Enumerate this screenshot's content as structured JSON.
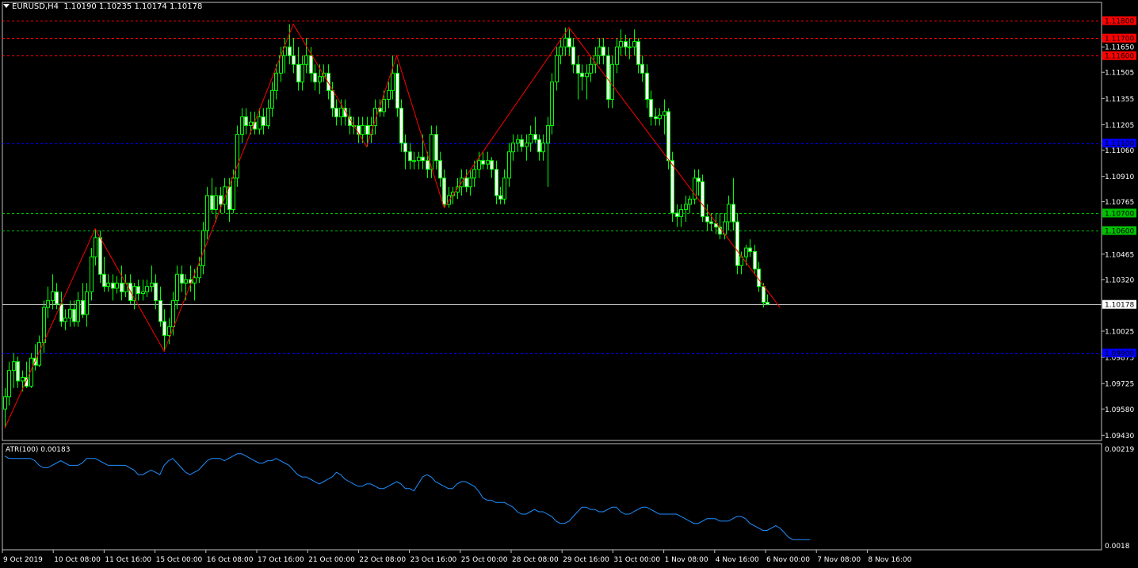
{
  "header": {
    "symbol": "EURUSD,H4",
    "ohlc": "1.10190 1.10235 1.10174 1.10178"
  },
  "indicator": {
    "label": "ATR(100) 0.00183",
    "ticks": [
      "0.00219",
      "0.0018"
    ]
  },
  "colors": {
    "background": "#000000",
    "bull": "#00ff00",
    "bear": "#ffffff",
    "zigzag": "#ff0000",
    "atr_line": "#1e90ff",
    "level_red": "#ff0000",
    "level_blue": "#0000ff",
    "level_green": "#00c000",
    "last_price": "#c0c0c0"
  },
  "chart_data": {
    "type": "candlestick",
    "symbol": "EURUSD",
    "timeframe": "H4",
    "ylim": [
      1.094,
      1.119
    ],
    "price_ticks": [
      "1.11650",
      "1.11505",
      "1.11355",
      "1.11205",
      "1.11060",
      "1.10910",
      "1.10765",
      "1.10465",
      "1.10320",
      "1.10025",
      "1.09875",
      "1.09725",
      "1.09580",
      "1.09430"
    ],
    "x_labels": [
      "9 Oct 2019",
      "10 Oct 08:00",
      "11 Oct 16:00",
      "15 Oct 00:00",
      "16 Oct 08:00",
      "17 Oct 16:00",
      "21 Oct 00:00",
      "22 Oct 08:00",
      "23 Oct 16:00",
      "25 Oct 00:00",
      "28 Oct 08:00",
      "29 Oct 16:00",
      "31 Oct 00:00",
      "1 Nov 08:00",
      "4 Nov 16:00",
      "6 Nov 00:00",
      "7 Nov 08:00",
      "8 Nov 16:00"
    ],
    "levels": [
      {
        "price": 1.118,
        "label": "1.11800",
        "color": "red"
      },
      {
        "price": 1.117,
        "label": "1.11700",
        "color": "red"
      },
      {
        "price": 1.116,
        "label": "1.11600",
        "color": "red"
      },
      {
        "price": 1.111,
        "label": "1.11100",
        "color": "blue"
      },
      {
        "price": 1.107,
        "label": "1.10700",
        "color": "green"
      },
      {
        "price": 1.106,
        "label": "1.10600",
        "color": "green"
      },
      {
        "price": 1.099,
        "label": "1.09900",
        "color": "blue"
      }
    ],
    "last_price": {
      "price": 1.10178,
      "label": "1.10178"
    },
    "zigzag": [
      {
        "bar": 0,
        "price": 1.0947
      },
      {
        "bar": 21,
        "price": 1.1061
      },
      {
        "bar": 37,
        "price": 1.0991
      },
      {
        "bar": 67,
        "price": 1.1178
      },
      {
        "bar": 84,
        "price": 1.1108
      },
      {
        "bar": 91,
        "price": 1.116
      },
      {
        "bar": 102,
        "price": 1.1073
      },
      {
        "bar": 131,
        "price": 1.1176
      },
      {
        "bar": 180,
        "price": 1.1016
      }
    ],
    "candles": [
      [
        1.0958,
        1.097,
        1.0947,
        1.0965
      ],
      [
        1.0965,
        1.0985,
        1.096,
        1.098
      ],
      [
        1.098,
        1.099,
        1.097,
        1.0985
      ],
      [
        1.0985,
        1.0988,
        1.097,
        1.0974
      ],
      [
        1.0974,
        1.098,
        1.0968,
        1.0976
      ],
      [
        1.0976,
        1.0985,
        1.097,
        1.0971
      ],
      [
        1.0971,
        1.099,
        1.097,
        1.0987
      ],
      [
        1.0987,
        1.0995,
        1.098,
        1.0983
      ],
      [
        1.0983,
        1.1,
        1.0982,
        1.0996
      ],
      [
        1.0996,
        1.102,
        1.099,
        1.1016
      ],
      [
        1.1016,
        1.1028,
        1.101,
        1.102
      ],
      [
        1.102,
        1.1035,
        1.1015,
        1.1025
      ],
      [
        1.1025,
        1.103,
        1.1015,
        1.1018
      ],
      [
        1.1018,
        1.1025,
        1.1005,
        1.1008
      ],
      [
        1.1008,
        1.1015,
        1.1003,
        1.101
      ],
      [
        1.101,
        1.102,
        1.1005,
        1.1015
      ],
      [
        1.1015,
        1.102,
        1.1005,
        1.1008
      ],
      [
        1.1008,
        1.1025,
        1.1005,
        1.102
      ],
      [
        1.102,
        1.103,
        1.101,
        1.1012
      ],
      [
        1.1012,
        1.103,
        1.1005,
        1.1025
      ],
      [
        1.1025,
        1.105,
        1.102,
        1.1045
      ],
      [
        1.1045,
        1.1061,
        1.104,
        1.1056
      ],
      [
        1.1056,
        1.106,
        1.103,
        1.1035
      ],
      [
        1.1035,
        1.1045,
        1.1025,
        1.1028
      ],
      [
        1.1028,
        1.1035,
        1.1025,
        1.103
      ],
      [
        1.103,
        1.1035,
        1.102,
        1.1027
      ],
      [
        1.1027,
        1.1034,
        1.1024,
        1.103
      ],
      [
        1.103,
        1.104,
        1.102,
        1.1025
      ],
      [
        1.1025,
        1.1035,
        1.1022,
        1.103
      ],
      [
        1.103,
        1.1035,
        1.1018,
        1.102
      ],
      [
        1.102,
        1.103,
        1.1015,
        1.1028
      ],
      [
        1.1028,
        1.1032,
        1.102,
        1.1024
      ],
      [
        1.1024,
        1.1032,
        1.102,
        1.1025
      ],
      [
        1.1025,
        1.1032,
        1.1022,
        1.1028
      ],
      [
        1.1028,
        1.104,
        1.1025,
        1.103
      ],
      [
        1.103,
        1.1035,
        1.1015,
        1.102
      ],
      [
        1.102,
        1.1028,
        1.1005,
        1.1008
      ],
      [
        1.1008,
        1.1015,
        1.0991,
        1.1
      ],
      [
        1.1,
        1.101,
        1.0995,
        1.1005
      ],
      [
        1.1005,
        1.1025,
        1.1,
        1.102
      ],
      [
        1.102,
        1.104,
        1.1015,
        1.1035
      ],
      [
        1.1035,
        1.104,
        1.1025,
        1.103
      ],
      [
        1.103,
        1.1035,
        1.102,
        1.1032
      ],
      [
        1.1032,
        1.104,
        1.1025,
        1.103
      ],
      [
        1.103,
        1.1038,
        1.102,
        1.1033
      ],
      [
        1.1033,
        1.1045,
        1.103,
        1.104
      ],
      [
        1.104,
        1.1065,
        1.1035,
        1.106
      ],
      [
        1.106,
        1.1085,
        1.1055,
        1.108
      ],
      [
        1.108,
        1.109,
        1.107,
        1.1072
      ],
      [
        1.1072,
        1.1085,
        1.1065,
        1.108
      ],
      [
        1.108,
        1.1085,
        1.107,
        1.1075
      ],
      [
        1.1075,
        1.109,
        1.107,
        1.1085
      ],
      [
        1.1085,
        1.109,
        1.1065,
        1.1072
      ],
      [
        1.1072,
        1.1095,
        1.107,
        1.109
      ],
      [
        1.109,
        1.112,
        1.1085,
        1.1115
      ],
      [
        1.1115,
        1.113,
        1.111,
        1.1125
      ],
      [
        1.1125,
        1.113,
        1.1115,
        1.112
      ],
      [
        1.112,
        1.1128,
        1.1115,
        1.1122
      ],
      [
        1.1122,
        1.1128,
        1.1115,
        1.1118
      ],
      [
        1.1118,
        1.113,
        1.1115,
        1.1125
      ],
      [
        1.1125,
        1.113,
        1.1115,
        1.112
      ],
      [
        1.112,
        1.1135,
        1.1118,
        1.113
      ],
      [
        1.113,
        1.1145,
        1.1125,
        1.114
      ],
      [
        1.114,
        1.1155,
        1.1135,
        1.115
      ],
      [
        1.115,
        1.1165,
        1.1145,
        1.116
      ],
      [
        1.116,
        1.117,
        1.115,
        1.1165
      ],
      [
        1.1165,
        1.1178,
        1.1155,
        1.116
      ],
      [
        1.116,
        1.117,
        1.115,
        1.1155
      ],
      [
        1.1155,
        1.1165,
        1.114,
        1.1145
      ],
      [
        1.1145,
        1.116,
        1.114,
        1.1155
      ],
      [
        1.1155,
        1.117,
        1.115,
        1.116
      ],
      [
        1.116,
        1.1165,
        1.1145,
        1.115
      ],
      [
        1.115,
        1.1155,
        1.114,
        1.1145
      ],
      [
        1.1145,
        1.1155,
        1.1138,
        1.1148
      ],
      [
        1.1148,
        1.1155,
        1.1145,
        1.115
      ],
      [
        1.115,
        1.1155,
        1.1135,
        1.114
      ],
      [
        1.114,
        1.1145,
        1.1125,
        1.113
      ],
      [
        1.113,
        1.1135,
        1.112,
        1.1125
      ],
      [
        1.1125,
        1.1135,
        1.112,
        1.113
      ],
      [
        1.113,
        1.1135,
        1.112,
        1.1125
      ],
      [
        1.1125,
        1.113,
        1.1115,
        1.112
      ],
      [
        1.112,
        1.1125,
        1.1115,
        1.112
      ],
      [
        1.112,
        1.1125,
        1.111,
        1.1115
      ],
      [
        1.1115,
        1.1125,
        1.111,
        1.112
      ],
      [
        1.112,
        1.1125,
        1.1108,
        1.1115
      ],
      [
        1.1115,
        1.1125,
        1.111,
        1.112
      ],
      [
        1.112,
        1.1135,
        1.1115,
        1.113
      ],
      [
        1.113,
        1.1135,
        1.1125,
        1.1128
      ],
      [
        1.1128,
        1.114,
        1.1125,
        1.1135
      ],
      [
        1.1135,
        1.1145,
        1.113,
        1.114
      ],
      [
        1.114,
        1.116,
        1.1135,
        1.115
      ],
      [
        1.115,
        1.1155,
        1.1125,
        1.113
      ],
      [
        1.113,
        1.1135,
        1.1105,
        1.111
      ],
      [
        1.111,
        1.1115,
        1.1095,
        1.1105
      ],
      [
        1.1105,
        1.111,
        1.1095,
        1.11
      ],
      [
        1.11,
        1.1105,
        1.1095,
        1.11
      ],
      [
        1.11,
        1.1105,
        1.1095,
        1.1102
      ],
      [
        1.1102,
        1.1115,
        1.1095,
        1.11
      ],
      [
        1.11,
        1.1105,
        1.109,
        1.1095
      ],
      [
        1.1095,
        1.112,
        1.109,
        1.1115
      ],
      [
        1.1115,
        1.112,
        1.1095,
        1.11
      ],
      [
        1.11,
        1.1105,
        1.1085,
        1.109
      ],
      [
        1.109,
        1.1095,
        1.1073,
        1.1075
      ],
      [
        1.1075,
        1.1085,
        1.1073,
        1.108
      ],
      [
        1.108,
        1.1085,
        1.1075,
        1.1082
      ],
      [
        1.1082,
        1.109,
        1.1078,
        1.1085
      ],
      [
        1.1085,
        1.1095,
        1.108,
        1.109
      ],
      [
        1.109,
        1.1095,
        1.1082,
        1.1085
      ],
      [
        1.1085,
        1.1095,
        1.108,
        1.109
      ],
      [
        1.109,
        1.11,
        1.1085,
        1.1095
      ],
      [
        1.1095,
        1.1105,
        1.109,
        1.11
      ],
      [
        1.11,
        1.1105,
        1.1095,
        1.1098
      ],
      [
        1.1098,
        1.1105,
        1.1095,
        1.11
      ],
      [
        1.11,
        1.1102,
        1.109,
        1.1095
      ],
      [
        1.1095,
        1.11,
        1.1075,
        1.108
      ],
      [
        1.108,
        1.1085,
        1.1075,
        1.1078
      ],
      [
        1.1078,
        1.1095,
        1.1075,
        1.109
      ],
      [
        1.109,
        1.111,
        1.1085,
        1.1105
      ],
      [
        1.1105,
        1.1115,
        1.11,
        1.111
      ],
      [
        1.111,
        1.1115,
        1.1105,
        1.1112
      ],
      [
        1.1112,
        1.1115,
        1.1105,
        1.1108
      ],
      [
        1.1108,
        1.1115,
        1.11,
        1.111
      ],
      [
        1.111,
        1.112,
        1.1105,
        1.1115
      ],
      [
        1.1115,
        1.1125,
        1.111,
        1.1112
      ],
      [
        1.1112,
        1.1115,
        1.11,
        1.1105
      ],
      [
        1.1105,
        1.1115,
        1.11,
        1.111
      ],
      [
        1.111,
        1.1125,
        1.1085,
        1.112
      ],
      [
        1.112,
        1.115,
        1.1115,
        1.1145
      ],
      [
        1.1145,
        1.1165,
        1.114,
        1.116
      ],
      [
        1.116,
        1.117,
        1.1155,
        1.1165
      ],
      [
        1.1165,
        1.1176,
        1.116,
        1.117
      ],
      [
        1.117,
        1.1175,
        1.116,
        1.1165
      ],
      [
        1.1165,
        1.117,
        1.115,
        1.1155
      ],
      [
        1.1155,
        1.116,
        1.1135,
        1.115
      ],
      [
        1.115,
        1.1155,
        1.114,
        1.1148
      ],
      [
        1.1148,
        1.1155,
        1.1135,
        1.115
      ],
      [
        1.115,
        1.116,
        1.1145,
        1.1155
      ],
      [
        1.1155,
        1.1165,
        1.115,
        1.116
      ],
      [
        1.116,
        1.117,
        1.1155,
        1.1165
      ],
      [
        1.1165,
        1.117,
        1.1155,
        1.116
      ],
      [
        1.116,
        1.1165,
        1.113,
        1.1135
      ],
      [
        1.1135,
        1.116,
        1.113,
        1.1155
      ],
      [
        1.1155,
        1.117,
        1.115,
        1.1165
      ],
      [
        1.1165,
        1.1175,
        1.116,
        1.1168
      ],
      [
        1.1168,
        1.1172,
        1.116,
        1.1165
      ],
      [
        1.1165,
        1.117,
        1.1158,
        1.1165
      ],
      [
        1.1165,
        1.1175,
        1.116,
        1.1168
      ],
      [
        1.1168,
        1.117,
        1.115,
        1.1155
      ],
      [
        1.1155,
        1.116,
        1.1145,
        1.115
      ],
      [
        1.115,
        1.1155,
        1.113,
        1.1135
      ],
      [
        1.1135,
        1.114,
        1.112,
        1.1125
      ],
      [
        1.1125,
        1.113,
        1.112,
        1.1124
      ],
      [
        1.1124,
        1.113,
        1.112,
        1.1126
      ],
      [
        1.1126,
        1.1135,
        1.1115,
        1.1128
      ],
      [
        1.1128,
        1.113,
        1.1095,
        1.11
      ],
      [
        1.11,
        1.1105,
        1.1065,
        1.107
      ],
      [
        1.107,
        1.1075,
        1.1062,
        1.1068
      ],
      [
        1.1068,
        1.1075,
        1.1062,
        1.1072
      ],
      [
        1.1072,
        1.108,
        1.1065,
        1.1075
      ],
      [
        1.1075,
        1.108,
        1.107,
        1.1078
      ],
      [
        1.1078,
        1.1095,
        1.1075,
        1.109
      ],
      [
        1.109,
        1.1095,
        1.108,
        1.1088
      ],
      [
        1.1088,
        1.1092,
        1.1065,
        1.1068
      ],
      [
        1.1068,
        1.1075,
        1.106,
        1.1065
      ],
      [
        1.1065,
        1.107,
        1.106,
        1.1064
      ],
      [
        1.1064,
        1.107,
        1.1058,
        1.1062
      ],
      [
        1.1062,
        1.107,
        1.1055,
        1.1058
      ],
      [
        1.1058,
        1.107,
        1.1055,
        1.1065
      ],
      [
        1.1065,
        1.108,
        1.106,
        1.1075
      ],
      [
        1.1075,
        1.109,
        1.106,
        1.1065
      ],
      [
        1.1065,
        1.107,
        1.1035,
        1.104
      ],
      [
        1.104,
        1.1048,
        1.1035,
        1.1045
      ],
      [
        1.1045,
        1.1052,
        1.104,
        1.105
      ],
      [
        1.105,
        1.1055,
        1.1045,
        1.1048
      ],
      [
        1.1048,
        1.1052,
        1.1035,
        1.1038
      ],
      [
        1.1038,
        1.1042,
        1.1025,
        1.1028
      ],
      [
        1.1028,
        1.103,
        1.1016,
        1.1019
      ],
      [
        1.1019,
        1.10235,
        1.10174,
        1.10178
      ]
    ],
    "atr": {
      "name": "ATR(100)",
      "ylim": [
        0.00178,
        0.00221
      ],
      "values": [
        0.00217,
        0.00216,
        0.00216,
        0.00216,
        0.00216,
        0.00216,
        0.00216,
        0.00215,
        0.00213,
        0.00212,
        0.00212,
        0.00213,
        0.00214,
        0.00215,
        0.00214,
        0.00213,
        0.00213,
        0.00213,
        0.00214,
        0.00216,
        0.00216,
        0.00216,
        0.00215,
        0.00214,
        0.00213,
        0.00213,
        0.00213,
        0.00213,
        0.00213,
        0.00212,
        0.00211,
        0.00209,
        0.00209,
        0.0021,
        0.00211,
        0.0021,
        0.00209,
        0.00213,
        0.00215,
        0.00216,
        0.00214,
        0.00212,
        0.0021,
        0.00209,
        0.0021,
        0.00211,
        0.00213,
        0.00215,
        0.00216,
        0.00216,
        0.00216,
        0.00215,
        0.00216,
        0.00217,
        0.00218,
        0.00218,
        0.00217,
        0.00216,
        0.00215,
        0.00214,
        0.00214,
        0.00215,
        0.00215,
        0.00216,
        0.00215,
        0.00214,
        0.00213,
        0.00211,
        0.00209,
        0.00208,
        0.00208,
        0.00207,
        0.00206,
        0.00205,
        0.00206,
        0.00207,
        0.00208,
        0.0021,
        0.00209,
        0.00207,
        0.00206,
        0.00205,
        0.00204,
        0.00204,
        0.00205,
        0.00205,
        0.00204,
        0.00203,
        0.00203,
        0.00204,
        0.00205,
        0.00206,
        0.00205,
        0.00203,
        0.00203,
        0.00202,
        0.00205,
        0.00208,
        0.00209,
        0.00208,
        0.00206,
        0.00205,
        0.00204,
        0.00203,
        0.00203,
        0.00205,
        0.00206,
        0.00206,
        0.00205,
        0.00204,
        0.00202,
        0.00199,
        0.00198,
        0.00198,
        0.00197,
        0.00197,
        0.00197,
        0.00196,
        0.00195,
        0.00193,
        0.00192,
        0.00192,
        0.00193,
        0.00194,
        0.00193,
        0.00193,
        0.00192,
        0.00191,
        0.00189,
        0.00188,
        0.00188,
        0.00189,
        0.00191,
        0.00193,
        0.00195,
        0.00195,
        0.00194,
        0.00194,
        0.00193,
        0.00193,
        0.00194,
        0.00195,
        0.00195,
        0.00193,
        0.00192,
        0.00192,
        0.00193,
        0.00194,
        0.00195,
        0.00195,
        0.00194,
        0.00193,
        0.00192,
        0.00192,
        0.00192,
        0.00192,
        0.00192,
        0.00191,
        0.0019,
        0.00189,
        0.00188,
        0.00188,
        0.00189,
        0.0019,
        0.0019,
        0.0019,
        0.00189,
        0.00189,
        0.00189,
        0.0019,
        0.00191,
        0.00191,
        0.0019,
        0.00188,
        0.00187,
        0.00186,
        0.00185,
        0.00185,
        0.00186,
        0.00187,
        0.00186,
        0.00184,
        0.00182,
        0.00181,
        0.00181,
        0.00181,
        0.00181,
        0.00181
      ]
    }
  }
}
